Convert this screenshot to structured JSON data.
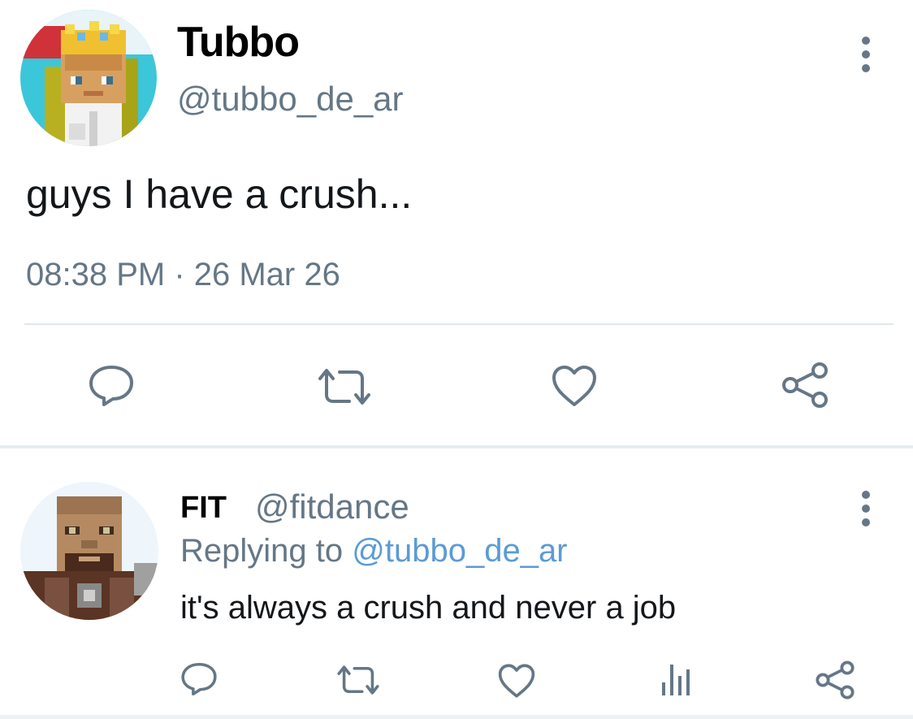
{
  "tweet": {
    "display_name": "Tubbo",
    "handle": "@tubbo_de_ar",
    "text": "guys I have a crush...",
    "timestamp": "08:38 PM · 26 Mar 26",
    "avatar_icon": "minecraft-skin-avatar"
  },
  "actions": [
    "reply",
    "retweet",
    "like",
    "share"
  ],
  "reply": {
    "display_name": "FIT",
    "handle": "@fitdance",
    "replying_prefix": "Replying to",
    "replying_to": "@tubbo_de_ar",
    "text": "it's always a crush and never a job",
    "avatar_icon": "minecraft-skin-avatar"
  },
  "reply_actions": [
    "reply",
    "retweet",
    "like",
    "analytics",
    "share"
  ],
  "colors": {
    "icon_gray": "#657786",
    "mention_blue": "#5b9bd5",
    "divider": "#e1e8ed"
  }
}
